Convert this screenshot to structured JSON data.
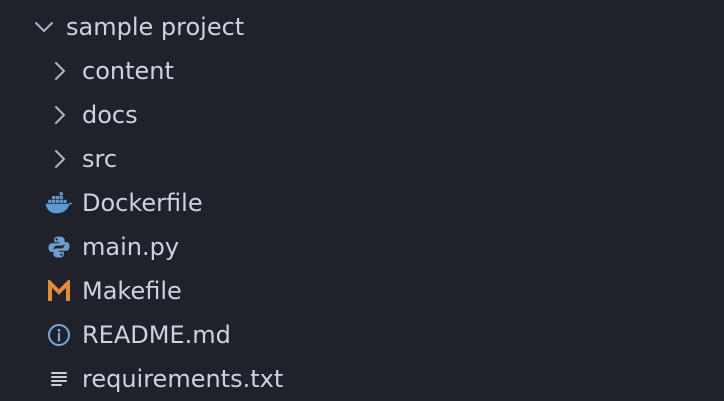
{
  "explorer": {
    "root": {
      "label": "sample project",
      "icon": "chevron-down-icon",
      "expanded": true
    },
    "items": [
      {
        "label": "content",
        "type": "folder",
        "icon": "chevron-right-icon"
      },
      {
        "label": "docs",
        "type": "folder",
        "icon": "chevron-right-icon"
      },
      {
        "label": "src",
        "type": "folder",
        "icon": "chevron-right-icon"
      },
      {
        "label": "Dockerfile",
        "type": "file",
        "icon": "docker-icon"
      },
      {
        "label": "main.py",
        "type": "file",
        "icon": "python-icon"
      },
      {
        "label": "Makefile",
        "type": "file",
        "icon": "makefile-icon"
      },
      {
        "label": "README.md",
        "type": "file",
        "icon": "info-icon"
      },
      {
        "label": "requirements.txt",
        "type": "file",
        "icon": "text-file-icon"
      }
    ]
  },
  "colors": {
    "background": "#1f222a",
    "text": "#cdd3de",
    "chevron": "#aeb4c0",
    "docker": "#5e9ad1",
    "python": "#6f9ccf",
    "makefile": "#e08a3c",
    "info": "#7aa7dc",
    "text_file": "#c8cdd6"
  }
}
